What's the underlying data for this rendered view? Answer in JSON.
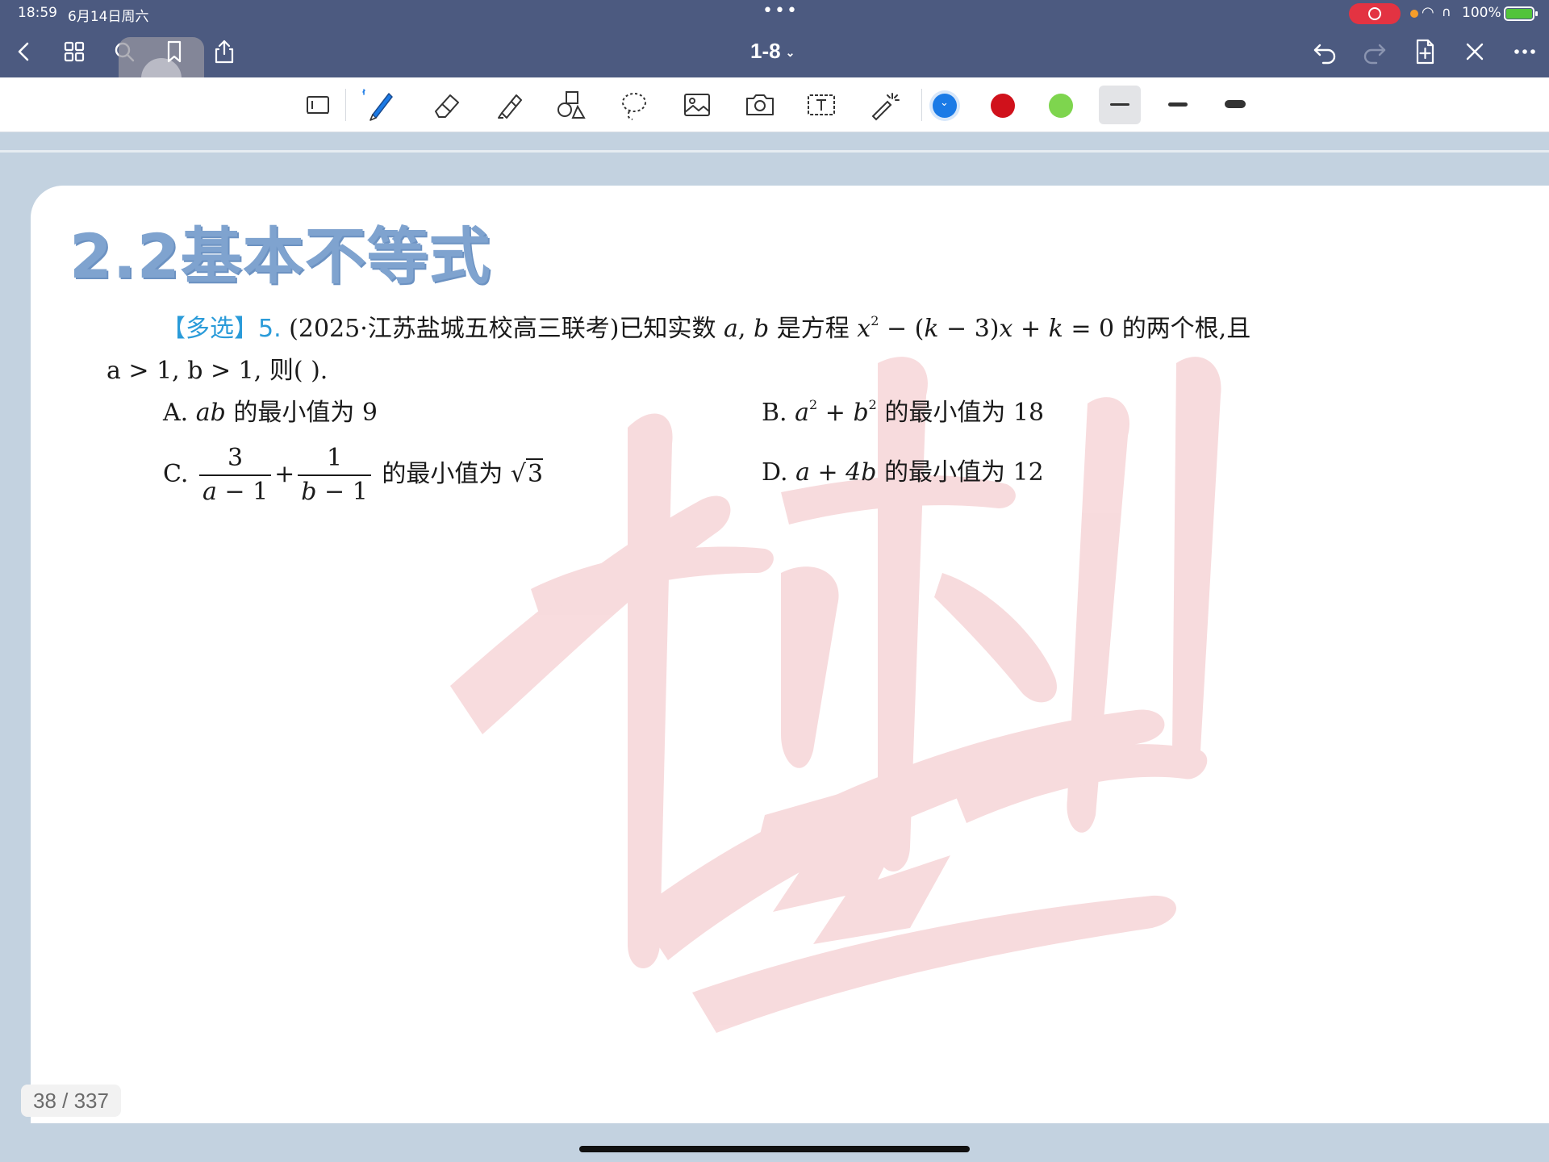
{
  "status_bar": {
    "time": "18:59",
    "date": "6月14日周六",
    "battery": "100%"
  },
  "nav": {
    "title": "1-8"
  },
  "toolbar": {
    "colors": [
      "#1a7ae6",
      "#d0111b",
      "#7ed54e"
    ],
    "selected_color": "#1a7ae6"
  },
  "page": {
    "section_title": "2.2基本不等式",
    "question": {
      "tag": "【多选】",
      "number": "5.",
      "source": "(2025·江苏盐城五校高三联考)",
      "stem_text": "已知实数",
      "equation_label": "是方程",
      "stem_end": "的两个根,且",
      "condition": "a > 1, b > 1, 则(        )."
    },
    "options": {
      "a_label": "A.",
      "a_expr": "ab",
      "a_text": "的最小值为 9",
      "b_label": "B.",
      "b_text": "的最小值为 18",
      "c_label": "C.",
      "c_text": "的最小值为",
      "d_label": "D.",
      "d_expr": "a + 4b",
      "d_text": "的最小值为 12"
    }
  },
  "page_indicator": "38 / 337"
}
